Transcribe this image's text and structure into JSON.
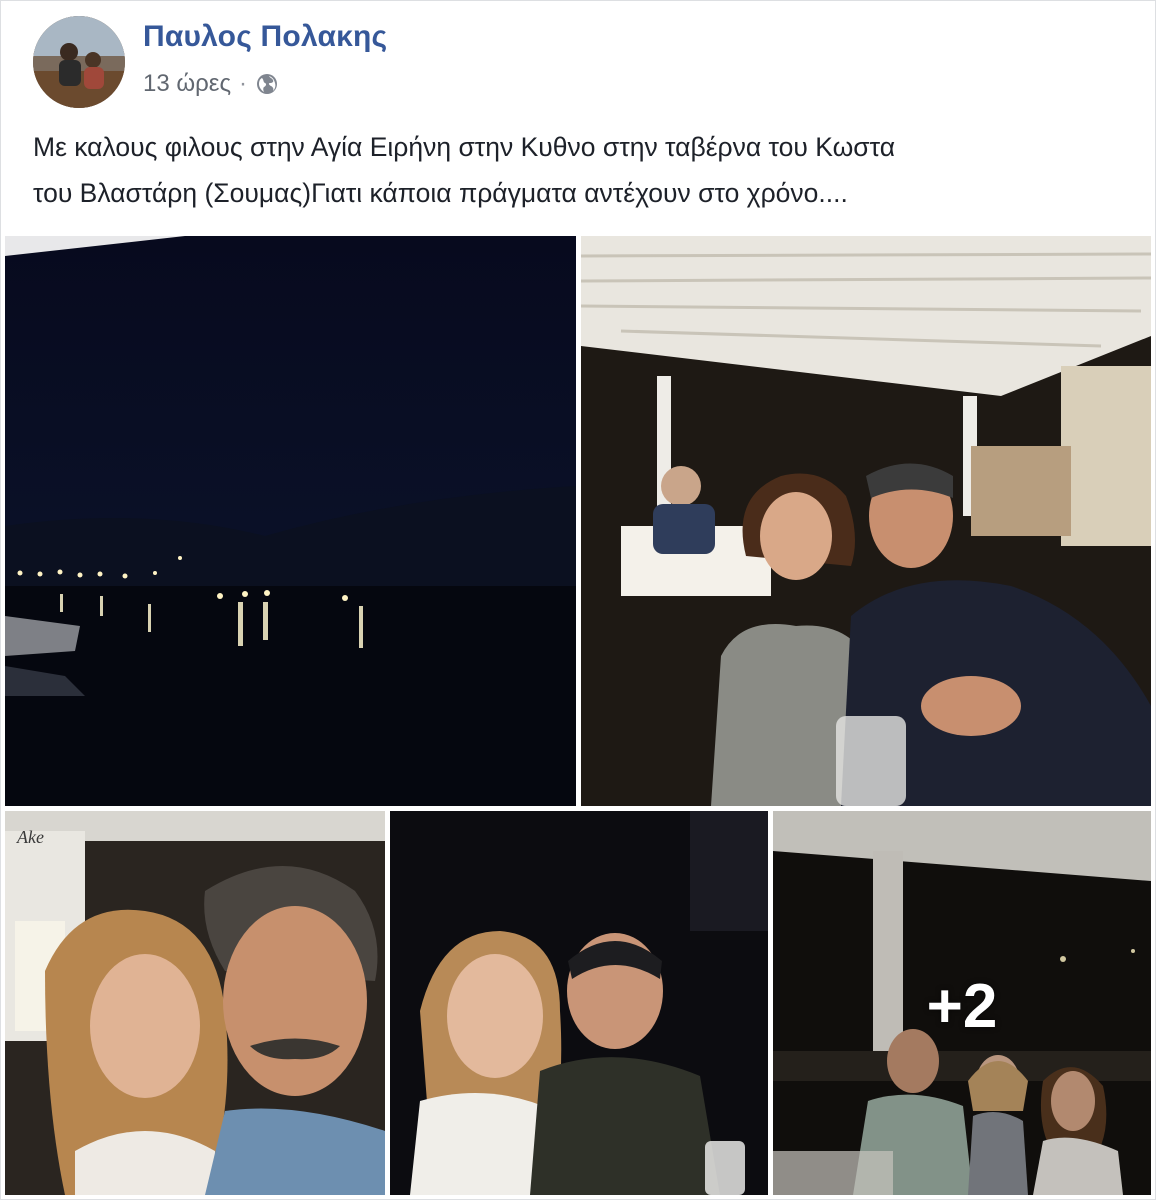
{
  "post": {
    "author": "Παυλος Πολακης",
    "time": "13 ώρες",
    "separator": "·",
    "privacy_icon": "globe-icon",
    "caption": "Με καλους φιλους στην Αγία Ειρήνη στην Κυθνο στην ταβέρνα του Κωστα\nτου Βλαστάρη (Σουμας)Γιατι κάποια πράγματα αντέχουν στο χρόνο...."
  },
  "photos": {
    "more_count": "+2"
  },
  "colors": {
    "author_link": "#365899",
    "meta_text": "#616770",
    "caption_text": "#1d2129"
  }
}
